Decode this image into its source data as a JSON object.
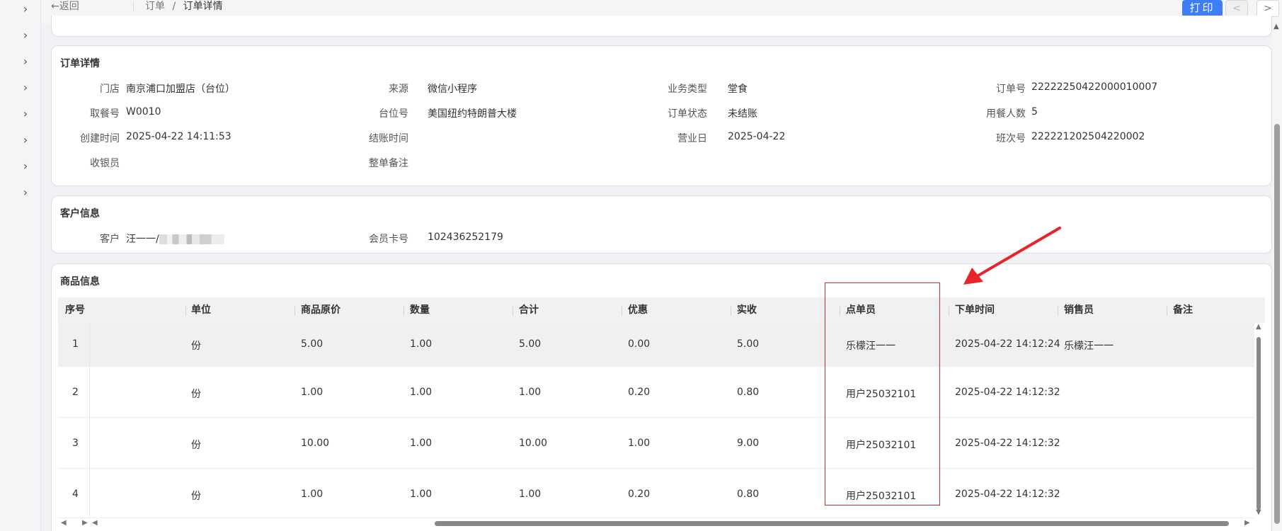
{
  "nav": {
    "back_label": "返回",
    "crumb_parent": "订单",
    "crumb_sep": "/",
    "crumb_current": "订单详情",
    "print_label": "打印",
    "prev_label": "<",
    "next_label": ">"
  },
  "order": {
    "title": "订单详情",
    "fields": {
      "store_label": "门店",
      "store_value": "南京浦口加盟店（台位）",
      "source_label": "来源",
      "source_value": "微信小程序",
      "biztype_label": "业务类型",
      "biztype_value": "堂食",
      "orderno_label": "订单号",
      "orderno_value": "22222250422000010007",
      "pickup_label": "取餐号",
      "pickup_value": "W0010",
      "table_label": "台位号",
      "table_value": "美国纽约特朗普大楼",
      "status_label": "订单状态",
      "status_value": "未结账",
      "diners_label": "用餐人数",
      "diners_value": "5",
      "created_label": "创建时间",
      "created_value": "2025-04-22 14:11:53",
      "checkout_label": "结账时间",
      "bizday_label": "营业日",
      "bizday_value": "2025-04-22",
      "shift_label": "班次号",
      "shift_value": "222221202504220002",
      "cashier_label": "收银员",
      "remark_label": "整单备注"
    }
  },
  "customer": {
    "title": "客户信息",
    "customer_label": "客户",
    "customer_value": "汪一一/",
    "card_label": "会员卡号",
    "card_value": "102436252179"
  },
  "products": {
    "title": "商品信息",
    "columns": [
      "序号",
      "单位",
      "商品原价",
      "数量",
      "合计",
      "优惠",
      "实收",
      "点单员",
      "下单时间",
      "销售员",
      "备注"
    ],
    "rows": [
      {
        "idx": "1",
        "unit": "份",
        "price": "5.00",
        "qty": "1.00",
        "total": "5.00",
        "discount": "0.00",
        "paid": "5.00",
        "orderer": "乐檬汪一一",
        "time": "2025-04-22 14:12:24",
        "seller": "乐檬汪一一",
        "note": ""
      },
      {
        "idx": "2",
        "unit": "份",
        "price": "1.00",
        "qty": "1.00",
        "total": "1.00",
        "discount": "0.20",
        "paid": "0.80",
        "orderer": "用户25032101",
        "time": "2025-04-22 14:12:32",
        "seller": "",
        "note": ""
      },
      {
        "idx": "3",
        "unit": "份",
        "price": "10.00",
        "qty": "1.00",
        "total": "10.00",
        "discount": "1.00",
        "paid": "9.00",
        "orderer": "用户25032101",
        "time": "2025-04-22 14:12:32",
        "seller": "",
        "note": ""
      },
      {
        "idx": "4",
        "unit": "份",
        "price": "1.00",
        "qty": "1.00",
        "total": "1.00",
        "discount": "0.20",
        "paid": "0.80",
        "orderer": "用户25032101",
        "time": "2025-04-22 14:12:32",
        "seller": "",
        "note": ""
      }
    ]
  },
  "colors": {
    "accent": "#3d7df5",
    "annotation": "#e8242b"
  },
  "icons": {
    "back": "arrow-left-icon",
    "rail": "chevron-right-icon",
    "annotation": "red-arrow-annotation"
  }
}
